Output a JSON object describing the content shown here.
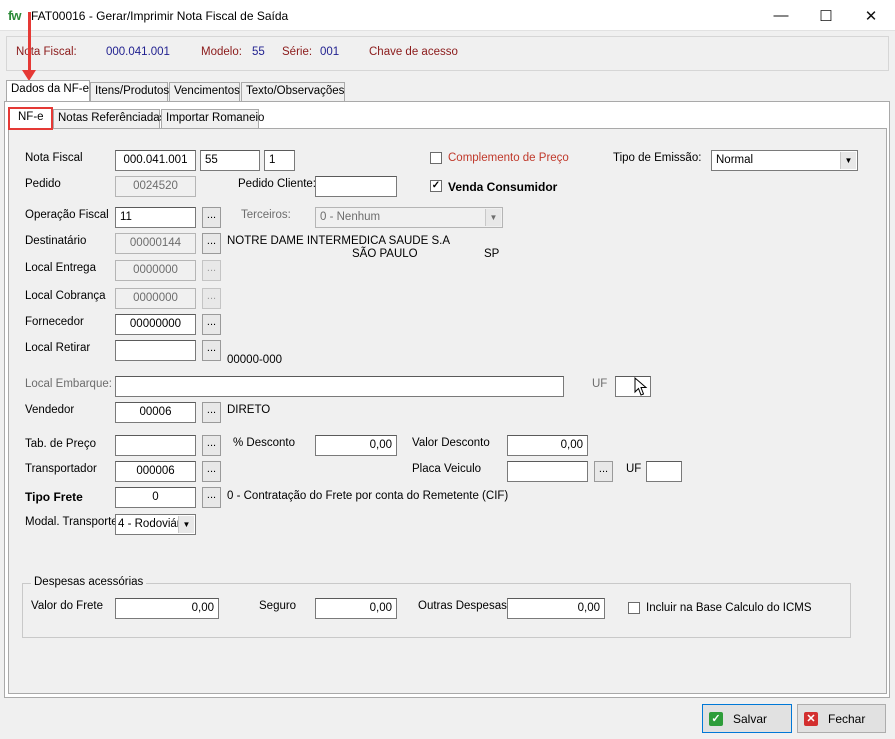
{
  "window": {
    "logo": "fw",
    "title": "FAT00016 - Gerar/Imprimir Nota Fiscal de Saída",
    "minimize": "—",
    "maximize": "☐",
    "close": "✕"
  },
  "header": {
    "nota_fiscal_label": "Nota Fiscal:",
    "nota_fiscal_value": "000.041.001",
    "modelo_label": "Modelo:",
    "modelo_value": "55",
    "serie_label": "Série:",
    "serie_value": "001",
    "chave_label": "Chave de acesso"
  },
  "main_tabs": [
    "Dados da NF-e",
    "Itens/Produtos",
    "Vencimentos",
    "Texto/Observações"
  ],
  "sub_tabs": [
    "NF-e",
    "Notas Referênciadas",
    "Importar Romaneio"
  ],
  "form": {
    "nota_fiscal": {
      "label": "Nota Fiscal",
      "numero": "000.041.001",
      "modelo": "55",
      "serie": "1"
    },
    "complemento_preco": {
      "label": "Complemento de Preço",
      "checked": false
    },
    "tipo_emissao": {
      "label": "Tipo de Emissão:",
      "value": "Normal"
    },
    "pedido": {
      "label": "Pedido",
      "value": "0024520"
    },
    "pedido_cliente": {
      "label": "Pedido Cliente:",
      "value": ""
    },
    "venda_consumidor": {
      "label": "Venda Consumidor",
      "checked": true,
      "mark": "✓"
    },
    "operacao_fiscal": {
      "label": "Operação Fiscal",
      "value": "11"
    },
    "terceiros": {
      "label": "Terceiros:",
      "value": "0 - Nenhum"
    },
    "destinatario": {
      "label": "Destinatário",
      "value": "00000144",
      "name": "NOTRE DAME INTERMEDICA SAUDE S.A",
      "city": "SÃO PAULO",
      "uf": "SP"
    },
    "local_entrega": {
      "label": "Local Entrega",
      "value": "0000000"
    },
    "local_cobranca": {
      "label": "Local Cobrança",
      "value": "0000000"
    },
    "fornecedor": {
      "label": "Fornecedor",
      "value": "00000000"
    },
    "local_retirar": {
      "label": "Local Retirar",
      "value": "",
      "extra": "00000-000"
    },
    "local_embarque": {
      "label": "Local Embarque:",
      "value": "",
      "uf_label": "UF",
      "uf_value": ""
    },
    "vendedor": {
      "label": "Vendedor",
      "value": "00006",
      "name": "DIRETO"
    },
    "tab_preco": {
      "label": "Tab. de Preço",
      "value": ""
    },
    "desconto_pct": {
      "label": "% Desconto",
      "value": "0,00"
    },
    "valor_desconto": {
      "label": "Valor Desconto",
      "value": "0,00"
    },
    "transportador": {
      "label": "Transportador",
      "value": "000006"
    },
    "placa_veiculo": {
      "label": "Placa Veiculo",
      "value": "",
      "uf_label": "UF",
      "uf_value": ""
    },
    "tipo_frete": {
      "label": "Tipo Frete",
      "value": "0",
      "description": "0 - Contratação do Frete por conta do Remetente (CIF)"
    },
    "modal_transporte": {
      "label": "Modal. Transporte",
      "value": "4 - Rodoviár"
    },
    "dots": "..."
  },
  "despesas": {
    "title": "Despesas acessórias",
    "valor_frete": {
      "label": "Valor do Frete",
      "value": "0,00"
    },
    "seguro": {
      "label": "Seguro",
      "value": "0,00"
    },
    "outras": {
      "label": "Outras Despesas",
      "value": "0,00"
    },
    "incluir_base": {
      "label": "Incluir na Base Calculo do ICMS",
      "checked": false
    }
  },
  "footer": {
    "save_label": "Salvar",
    "close_label": "Fechar"
  },
  "colors": {
    "accent_red": "#e53935",
    "header_label": "#8b1a1a",
    "header_value": "#1f1f8f",
    "logo_green": "#2e8b3a"
  }
}
